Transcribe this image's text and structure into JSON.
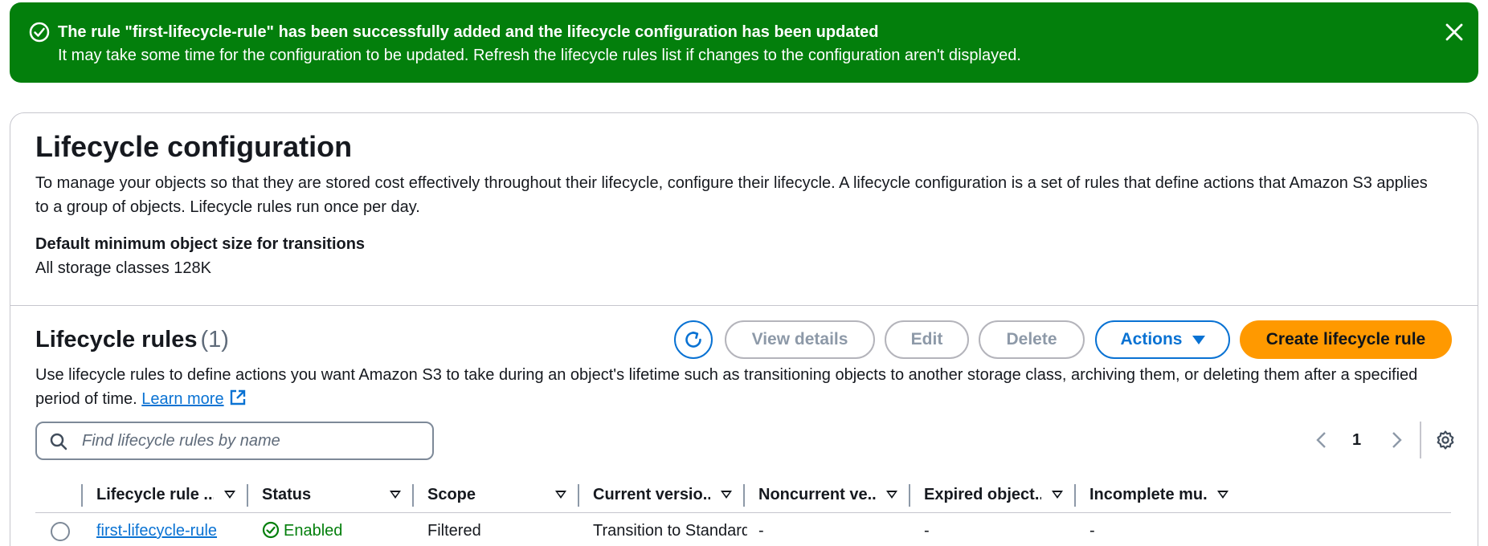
{
  "flash": {
    "title": "The rule \"first-lifecycle-rule\" has been successfully added and the lifecycle configuration has been updated",
    "message": "It may take some time for the configuration to be updated. Refresh the lifecycle rules list if changes to the configuration aren't displayed.",
    "type": "success",
    "color": "#037f0c"
  },
  "config": {
    "title": "Lifecycle configuration",
    "description": "To manage your objects so that they are stored cost effectively throughout their lifecycle, configure their lifecycle. A lifecycle configuration is a set of rules that define actions that Amazon S3 applies to a group of objects. Lifecycle rules run once per day.",
    "min_size_label": "Default minimum object size for transitions",
    "min_size_value": "All storage classes 128K"
  },
  "rules": {
    "title": "Lifecycle rules",
    "count": "(1)",
    "description": "Use lifecycle rules to define actions you want Amazon S3 to take during an object's lifetime such as transitioning objects to another storage class, archiving them, or deleting them after a specified period of time.",
    "learn_more": "Learn more",
    "buttons": {
      "view": "View details",
      "edit": "Edit",
      "delete": "Delete",
      "actions": "Actions",
      "create": "Create lifecycle rule"
    },
    "search_placeholder": "Find lifecycle rules by name",
    "page": "1",
    "columns": [
      "Lifecycle rule ...",
      "Status",
      "Scope",
      "Current versio...",
      "Noncurrent ve...",
      "Expired object...",
      "Incomplete mu..."
    ],
    "rows": [
      {
        "name": "first-lifecycle-rule",
        "status": "Enabled",
        "scope": "Filtered",
        "current": "Transition to Standard-",
        "noncurrent": "-",
        "expired": "-",
        "incomplete": "-"
      }
    ]
  },
  "colors": {
    "primary": "#0972d3",
    "accent": "#ff9900",
    "success": "#037f0c"
  }
}
